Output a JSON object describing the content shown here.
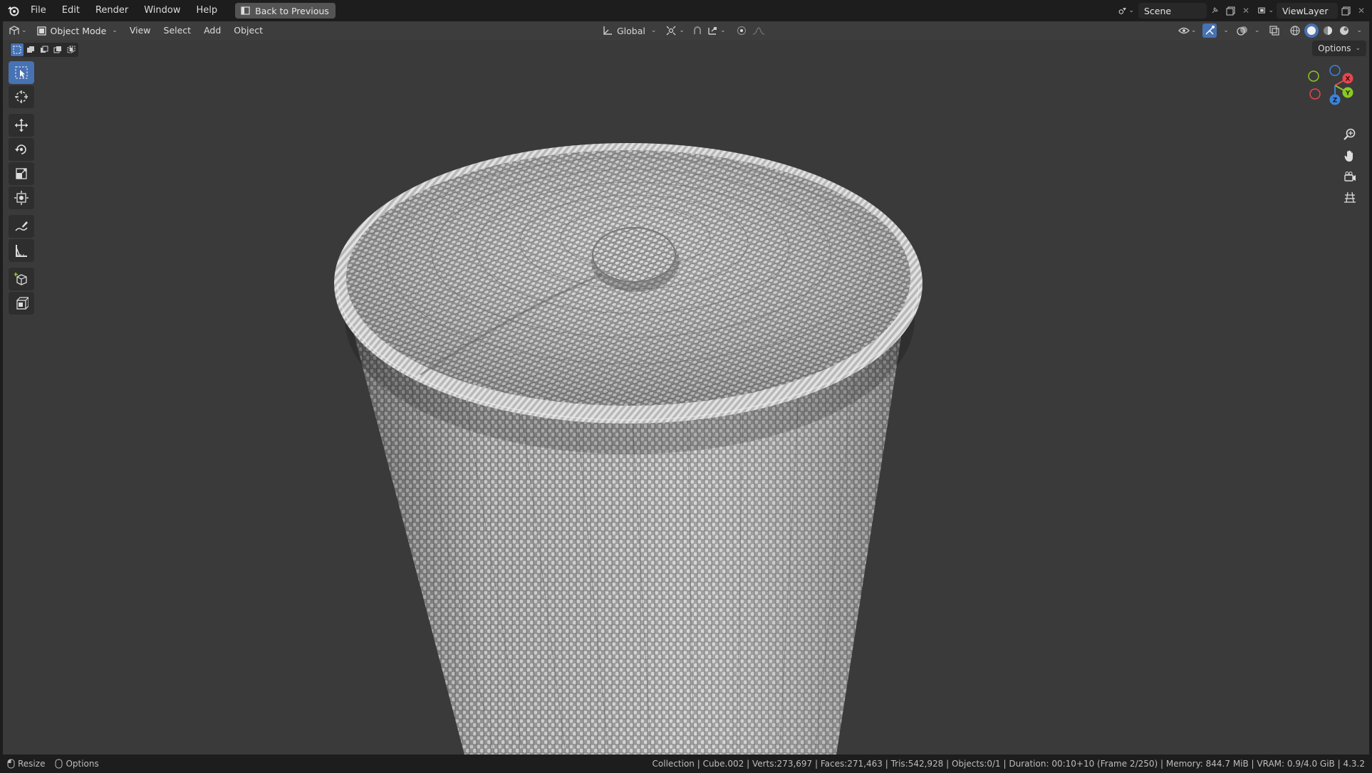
{
  "menubar": {
    "items": [
      "File",
      "Edit",
      "Render",
      "Window",
      "Help"
    ],
    "back_button": "Back to Previous",
    "scene_name": "Scene",
    "view_layer_name": "ViewLayer"
  },
  "header": {
    "mode": "Object Mode",
    "menus": [
      "View",
      "Select",
      "Add",
      "Object"
    ],
    "transform_orientation": "Global",
    "options_label": "Options"
  },
  "gizmo": {
    "x_label": "X",
    "y_label": "Y",
    "z_label": "Z"
  },
  "statusbar": {
    "left_items": [
      "Resize",
      "Options"
    ],
    "info": "Collection | Cube.002 | Verts:273,697 | Faces:271,463 | Tris:542,928 | Objects:0/1 | Duration: 00:10+10 (Frame 2/250) | Memory: 844.7 MiB | VRAM: 0.9/4.0 GiB | 4.3.2"
  },
  "colors": {
    "accent": "#4772b3",
    "viewport_bg": "#3a3a3a",
    "axis_x": "#e5474f",
    "axis_y": "#8bc825",
    "axis_z": "#3e82d8"
  },
  "icons": {
    "logo": "blender-logo-icon",
    "tools": [
      "select-box-icon",
      "cursor-icon",
      "move-icon",
      "rotate-icon",
      "scale-icon",
      "transform-icon",
      "annotate-icon",
      "measure-icon",
      "add-cube-icon",
      "add-cube-2-icon"
    ],
    "nav": [
      "zoom-icon",
      "pan-hand-icon",
      "camera-icon",
      "grid-ortho-icon"
    ]
  }
}
